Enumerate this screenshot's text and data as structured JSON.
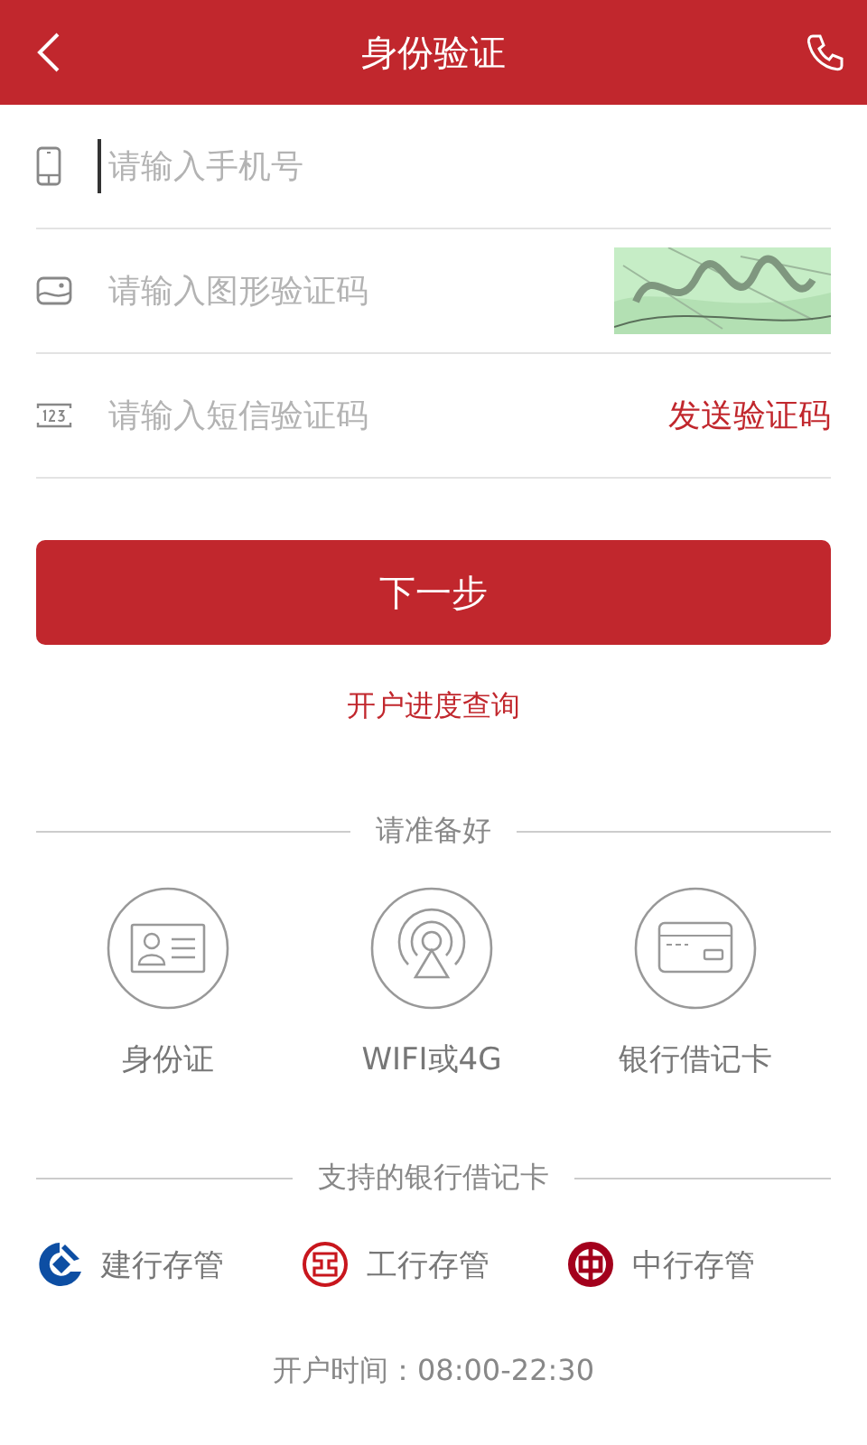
{
  "header": {
    "title": "身份验证"
  },
  "fields": [
    {
      "kind": "phone",
      "placeholder": "请输入手机号",
      "focused": true
    },
    {
      "kind": "captcha",
      "placeholder": "请输入图形验证码",
      "focused": false
    },
    {
      "kind": "sms",
      "placeholder": "请输入短信验证码",
      "focused": false,
      "action": "发送验证码"
    }
  ],
  "next_button": "下一步",
  "progress_link": "开户进度查询",
  "prepare": {
    "title": "请准备好",
    "items": [
      {
        "kind": "id",
        "label": "身份证"
      },
      {
        "kind": "network",
        "label": "WIFI或4G"
      },
      {
        "kind": "card",
        "label": "银行借记卡"
      }
    ]
  },
  "banks": {
    "title": "支持的银行借记卡",
    "items": [
      {
        "kind": "ccb",
        "label": "建行存管",
        "color": "#0d4ea3"
      },
      {
        "kind": "icbc",
        "label": "工行存管",
        "color": "#c8161d"
      },
      {
        "kind": "boc",
        "label": "中行存管",
        "color": "#a3001c"
      }
    ]
  },
  "hours": "开户时间：08:00-22:30"
}
